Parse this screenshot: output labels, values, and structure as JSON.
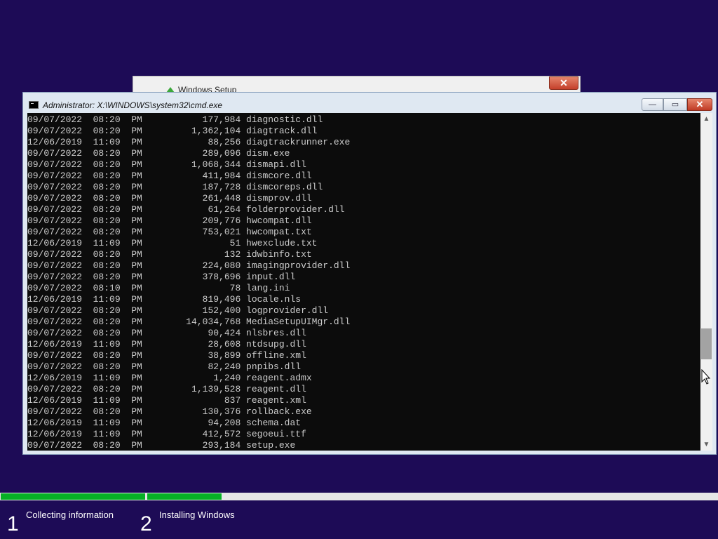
{
  "setup_window": {
    "title": "Windows Setup",
    "close_glyph": "✕"
  },
  "cmd_window": {
    "title": "Administrator: X:\\WINDOWS\\system32\\cmd.exe",
    "min_glyph": "—",
    "max_glyph": "▭",
    "close_glyph": "✕",
    "scroll_position": 0.72
  },
  "files": [
    {
      "date": "09/07/2022",
      "time": "08:20 PM",
      "size": "177,984",
      "name": "diagnostic.dll"
    },
    {
      "date": "09/07/2022",
      "time": "08:20 PM",
      "size": "1,362,104",
      "name": "diagtrack.dll"
    },
    {
      "date": "12/06/2019",
      "time": "11:09 PM",
      "size": "88,256",
      "name": "diagtrackrunner.exe"
    },
    {
      "date": "09/07/2022",
      "time": "08:20 PM",
      "size": "289,096",
      "name": "dism.exe"
    },
    {
      "date": "09/07/2022",
      "time": "08:20 PM",
      "size": "1,068,344",
      "name": "dismapi.dll"
    },
    {
      "date": "09/07/2022",
      "time": "08:20 PM",
      "size": "411,984",
      "name": "dismcore.dll"
    },
    {
      "date": "09/07/2022",
      "time": "08:20 PM",
      "size": "187,728",
      "name": "dismcoreps.dll"
    },
    {
      "date": "09/07/2022",
      "time": "08:20 PM",
      "size": "261,448",
      "name": "dismprov.dll"
    },
    {
      "date": "09/07/2022",
      "time": "08:20 PM",
      "size": "61,264",
      "name": "folderprovider.dll"
    },
    {
      "date": "09/07/2022",
      "time": "08:20 PM",
      "size": "209,776",
      "name": "hwcompat.dll"
    },
    {
      "date": "09/07/2022",
      "time": "08:20 PM",
      "size": "753,021",
      "name": "hwcompat.txt"
    },
    {
      "date": "12/06/2019",
      "time": "11:09 PM",
      "size": "51",
      "name": "hwexclude.txt"
    },
    {
      "date": "09/07/2022",
      "time": "08:20 PM",
      "size": "132",
      "name": "idwbinfo.txt"
    },
    {
      "date": "09/07/2022",
      "time": "08:20 PM",
      "size": "224,080",
      "name": "imagingprovider.dll"
    },
    {
      "date": "09/07/2022",
      "time": "08:20 PM",
      "size": "378,696",
      "name": "input.dll"
    },
    {
      "date": "09/07/2022",
      "time": "08:10 PM",
      "size": "78",
      "name": "lang.ini"
    },
    {
      "date": "12/06/2019",
      "time": "11:09 PM",
      "size": "819,496",
      "name": "locale.nls"
    },
    {
      "date": "09/07/2022",
      "time": "08:20 PM",
      "size": "152,400",
      "name": "logprovider.dll"
    },
    {
      "date": "09/07/2022",
      "time": "08:20 PM",
      "size": "14,034,768",
      "name": "MediaSetupUIMgr.dll"
    },
    {
      "date": "09/07/2022",
      "time": "08:20 PM",
      "size": "90,424",
      "name": "nlsbres.dll"
    },
    {
      "date": "12/06/2019",
      "time": "11:09 PM",
      "size": "28,608",
      "name": "ntdsupg.dll"
    },
    {
      "date": "09/07/2022",
      "time": "08:20 PM",
      "size": "38,899",
      "name": "offline.xml"
    },
    {
      "date": "09/07/2022",
      "time": "08:20 PM",
      "size": "82,240",
      "name": "pnpibs.dll"
    },
    {
      "date": "12/06/2019",
      "time": "11:09 PM",
      "size": "1,240",
      "name": "reagent.admx"
    },
    {
      "date": "09/07/2022",
      "time": "08:20 PM",
      "size": "1,139,528",
      "name": "reagent.dll"
    },
    {
      "date": "12/06/2019",
      "time": "11:09 PM",
      "size": "837",
      "name": "reagent.xml"
    },
    {
      "date": "09/07/2022",
      "time": "08:20 PM",
      "size": "130,376",
      "name": "rollback.exe"
    },
    {
      "date": "12/06/2019",
      "time": "11:09 PM",
      "size": "94,208",
      "name": "schema.dat"
    },
    {
      "date": "12/06/2019",
      "time": "11:09 PM",
      "size": "412,572",
      "name": "segoeui.ttf"
    },
    {
      "date": "09/07/2022",
      "time": "08:20 PM",
      "size": "293,184",
      "name": "setup.exe"
    }
  ],
  "setup_progress": {
    "steps": [
      {
        "number": "1",
        "label": "Collecting information",
        "progress": 1.0
      },
      {
        "number": "2",
        "label": "Installing Windows",
        "progress": 0.13
      }
    ]
  },
  "colors": {
    "background": "#1d0b56",
    "console_bg": "#0c0c0c",
    "console_text": "#cccccc",
    "progress_fill": "#06b025",
    "progress_track": "#e6e6e6"
  }
}
